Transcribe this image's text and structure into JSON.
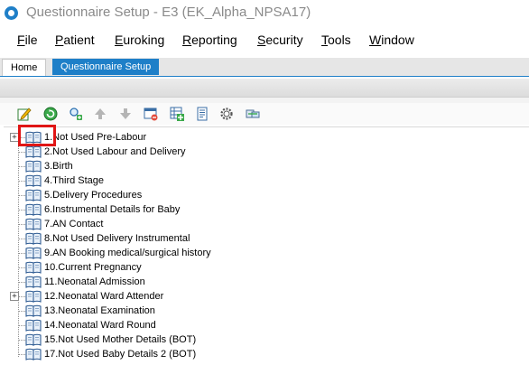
{
  "window": {
    "title": "Questionnaire Setup - E3 (EK_Alpha_NPSA17)"
  },
  "menu": [
    "File",
    "Patient",
    "Euroking",
    "Reporting",
    "Security",
    "Tools",
    "Window"
  ],
  "tabs": {
    "home": "Home",
    "active": "Questionnaire Setup"
  },
  "toolbar_icons": [
    "edit-icon",
    "add-icon",
    "search-add-icon",
    "move-up-icon",
    "move-down-icon",
    "remove-item-icon",
    "add-table-icon",
    "document-icon",
    "settings-gear-icon",
    "link-icon"
  ],
  "colors": {
    "accent": "#1e7fc8",
    "highlight": "#e01515"
  },
  "tree": {
    "items": [
      {
        "label": "1.Not Used Pre-Labour",
        "expandable": true,
        "highlighted": true
      },
      {
        "label": "2.Not Used Labour and Delivery",
        "expandable": false
      },
      {
        "label": "3.Birth",
        "expandable": false
      },
      {
        "label": "4.Third Stage",
        "expandable": false
      },
      {
        "label": "5.Delivery Procedures",
        "expandable": false
      },
      {
        "label": "6.Instrumental Details for Baby",
        "expandable": false
      },
      {
        "label": "7.AN Contact",
        "expandable": false
      },
      {
        "label": "8.Not Used Delivery Instrumental",
        "expandable": false
      },
      {
        "label": "9.AN Booking medical/surgical history",
        "expandable": false
      },
      {
        "label": "10.Current Pregnancy",
        "expandable": false
      },
      {
        "label": "11.Neonatal Admission",
        "expandable": false
      },
      {
        "label": "12.Neonatal Ward Attender",
        "expandable": true
      },
      {
        "label": "13.Neonatal Examination",
        "expandable": false
      },
      {
        "label": "14.Neonatal Ward Round",
        "expandable": false
      },
      {
        "label": "15.Not Used Mother Details (BOT)",
        "expandable": false
      },
      {
        "label": "17.Not Used Baby Details 2 (BOT)",
        "expandable": false
      }
    ]
  }
}
